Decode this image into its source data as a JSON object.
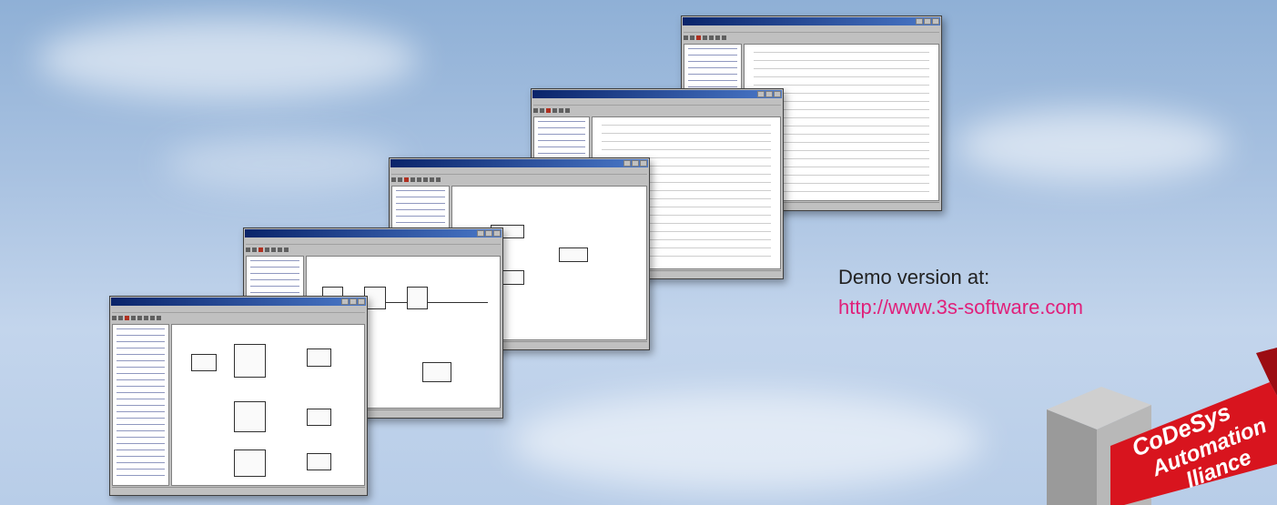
{
  "demo": {
    "label": "Demo version at:",
    "url_text": "http://www.3s-software.com"
  },
  "logo": {
    "line1": "CoDeSys",
    "line2": "Automation",
    "line3": "lliance"
  },
  "colors": {
    "link": "#e0207a",
    "logo_red": "#d8141e",
    "title_bar": "#0a246a"
  }
}
